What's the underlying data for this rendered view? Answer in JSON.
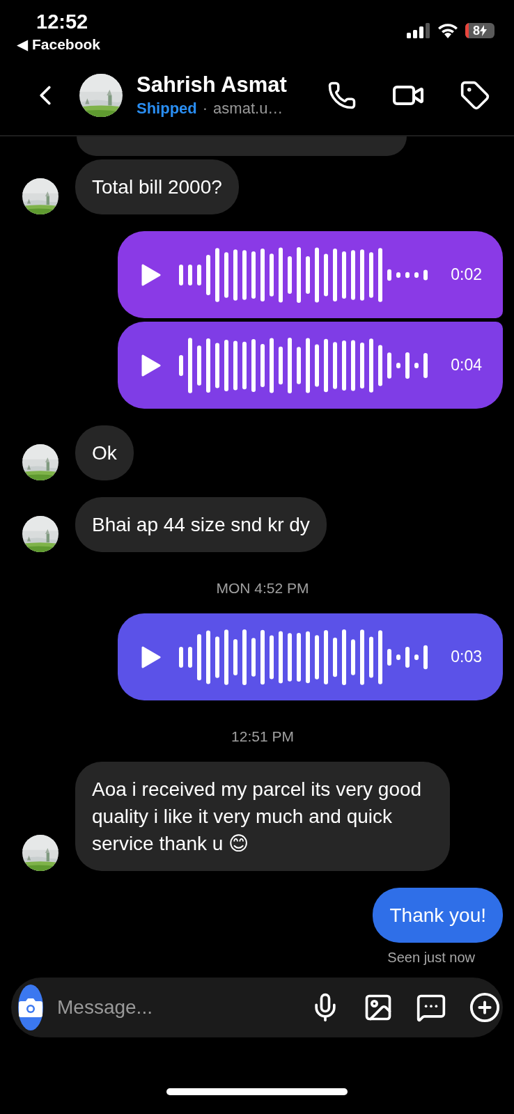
{
  "status_bar": {
    "time": "12:52",
    "back_app": "◀ Facebook",
    "battery": "8"
  },
  "header": {
    "name": "Sahrish Asmat",
    "label": "Shipped",
    "handle_separator": "·",
    "handle": "asmat.u…"
  },
  "messages": [
    {
      "kind": "incoming_cut_off"
    },
    {
      "kind": "incoming_text",
      "text": "Total bill 2000?"
    },
    {
      "kind": "outgoing_voice",
      "duration": "0:02",
      "color": "#8a3ae6"
    },
    {
      "kind": "outgoing_voice",
      "duration": "0:04",
      "color": "#7f3de6"
    },
    {
      "kind": "incoming_text",
      "text": "Ok"
    },
    {
      "kind": "incoming_text",
      "text": "Bhai ap 44 size snd kr dy"
    },
    {
      "kind": "time",
      "text": "MON 4:52 PM"
    },
    {
      "kind": "outgoing_voice",
      "duration": "0:03",
      "color": "#5b52e8"
    },
    {
      "kind": "time",
      "text": "12:51 PM"
    },
    {
      "kind": "incoming_text",
      "text": "Aoa i received my parcel its very good quality i like it very much and quick service thank u 😊"
    },
    {
      "kind": "outgoing_text",
      "text": "Thank you!",
      "color": "#2f6fe8"
    }
  ],
  "seen": "Seen just now",
  "composer": {
    "placeholder": "Message..."
  }
}
